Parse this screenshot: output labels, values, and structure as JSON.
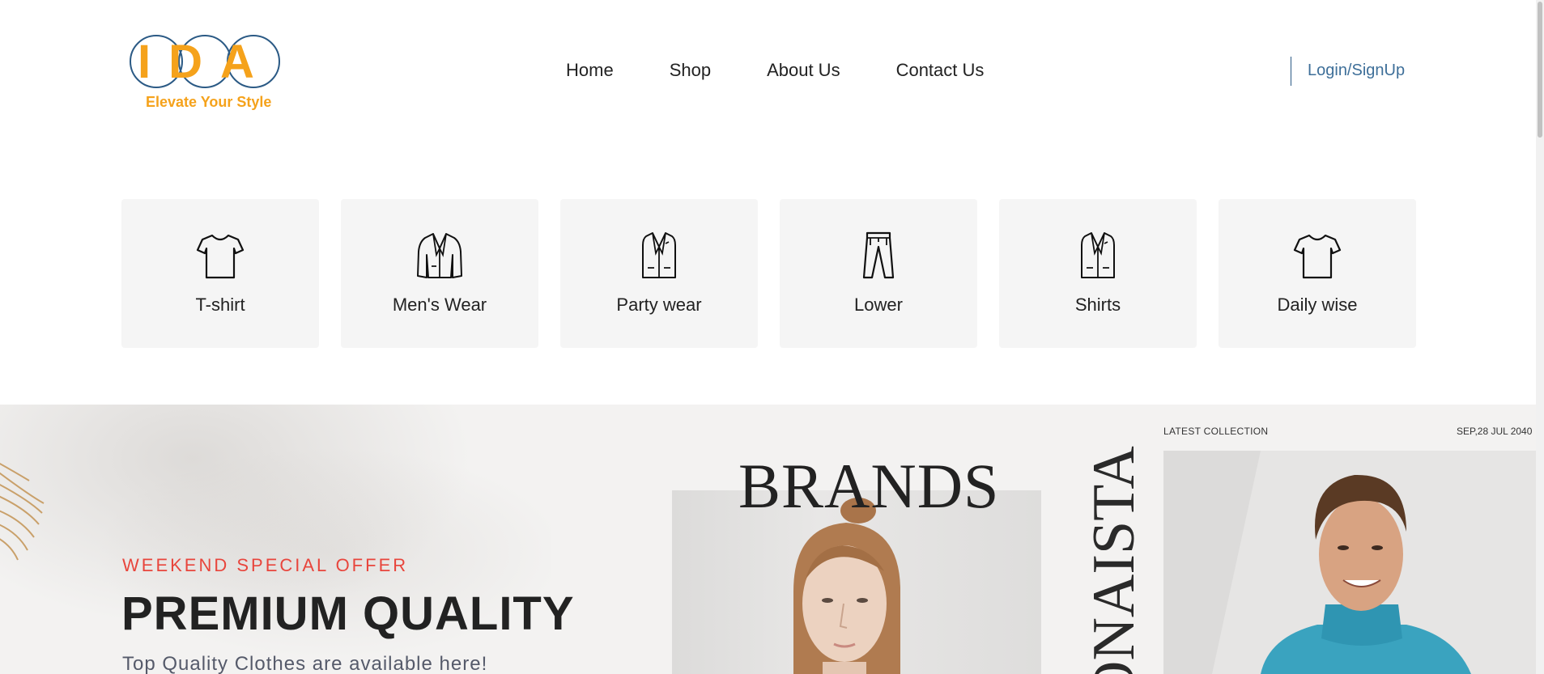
{
  "logo": {
    "letters": "IDA",
    "tagline": "Elevate Your Style",
    "colors": {
      "letters": "#f5a21b",
      "rings": "#2b5a85"
    }
  },
  "nav": {
    "items": [
      "Home",
      "Shop",
      "About Us",
      "Contact Us"
    ]
  },
  "auth": {
    "login_label": "Login/SignUp"
  },
  "categories": [
    {
      "label": "T-shirt",
      "icon": "tshirt-icon"
    },
    {
      "label": "Men's Wear",
      "icon": "blazer-icon"
    },
    {
      "label": "Party wear",
      "icon": "suit-jacket-icon"
    },
    {
      "label": "Lower",
      "icon": "trousers-icon"
    },
    {
      "label": "Shirts",
      "icon": "suit-jacket-icon"
    },
    {
      "label": "Daily wise",
      "icon": "tshirt-icon"
    }
  ],
  "hero": {
    "offer": "WEEKEND SPECIAL OFFER",
    "title": "PREMIUM QUALITY",
    "subtitle": "Top Quality Clothes are available here!",
    "brands_word": "BRANDS",
    "vertical_word": "ONAISTA",
    "latest_collection": "LATEST COLLECTION",
    "date": "SEP,28 JUL 2040",
    "colors": {
      "offer": "#e8453c",
      "accent_blue": "#2b5a85"
    }
  }
}
